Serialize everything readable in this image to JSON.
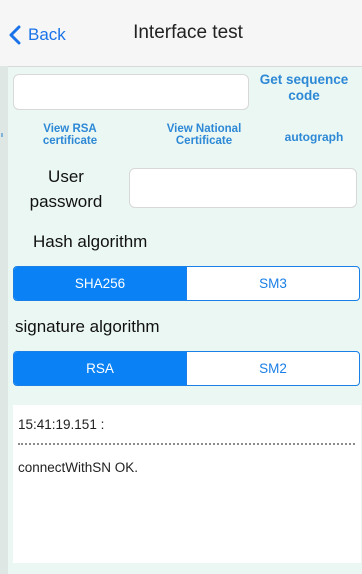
{
  "header": {
    "back_label": "Back",
    "title": "Interface test"
  },
  "serial": {
    "input_value": "",
    "get_sequence_label": "Get sequence code"
  },
  "actions": {
    "view_rsa_label": "View RSA certificate",
    "view_national_label": "View National Certificate",
    "autograph_label": "autograph"
  },
  "password": {
    "label": "User password",
    "value": ""
  },
  "hash": {
    "label": "Hash algorithm",
    "options": [
      "SHA256",
      "SM3"
    ],
    "selected": "SHA256"
  },
  "signature": {
    "label": "signature algorithm",
    "options": [
      "RSA",
      "SM2"
    ],
    "selected": "RSA"
  },
  "log": {
    "timestamp": "15:41:19.151 :",
    "message": "connectWithSN OK."
  },
  "colors": {
    "accent": "#0a82f5",
    "link": "#2d88d6",
    "background": "#eaf7f3"
  },
  "icons": {
    "back": "chevron-left-icon"
  }
}
